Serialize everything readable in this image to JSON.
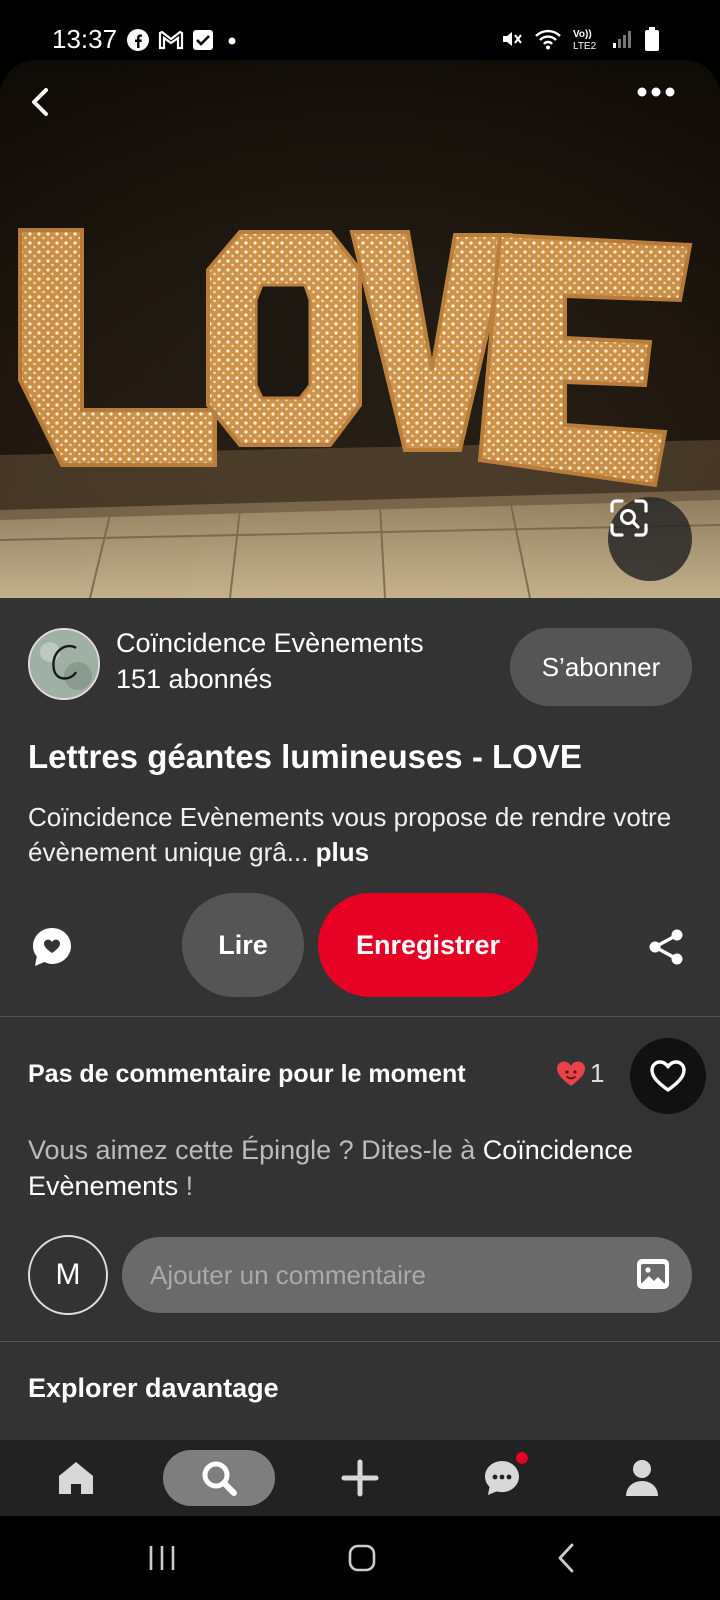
{
  "status_bar": {
    "time": "13:37",
    "left_icons": [
      "facebook-icon",
      "gmail-icon",
      "check-icon",
      "dot-icon"
    ],
    "right_icons": [
      "mute-icon",
      "wifi-icon",
      "volte-icon",
      "signal-icon",
      "battery-icon"
    ],
    "network_label": "VoLTE2"
  },
  "hero": {
    "image_subject": "LOVE",
    "actions": [
      "back-icon",
      "more-icon",
      "visual-search-icon"
    ]
  },
  "creator": {
    "name": "Coïncidence Evènements",
    "followers": "151 abonnés",
    "follow_label": "S’abonner"
  },
  "pin": {
    "title": "Lettres géantes lumineuses - LOVE",
    "description": "Coïncidence Evènements vous propose de rendre votre évènement unique grâ... ",
    "more_label": "plus"
  },
  "actions": {
    "read_label": "Lire",
    "save_label": "Enregistrer"
  },
  "comments": {
    "heading": "Pas de commentaire pour le moment",
    "reaction_count": "1",
    "prompt_prefix": "Vous aimez cette Épingle ? Dites-le à ",
    "prompt_name": "Coïncidence Evènements",
    "prompt_suffix": " !",
    "user_initial": "M",
    "input_placeholder": "Ajouter un commentaire"
  },
  "explore": {
    "title": "Explorer davantage"
  },
  "bottom_nav": {
    "items": [
      "home-icon",
      "search-icon",
      "create-icon",
      "messages-icon",
      "profile-icon"
    ],
    "active": "search-icon"
  },
  "colors": {
    "accent": "#e60023",
    "sheet_bg": "#333333",
    "button_gray": "#555555"
  }
}
